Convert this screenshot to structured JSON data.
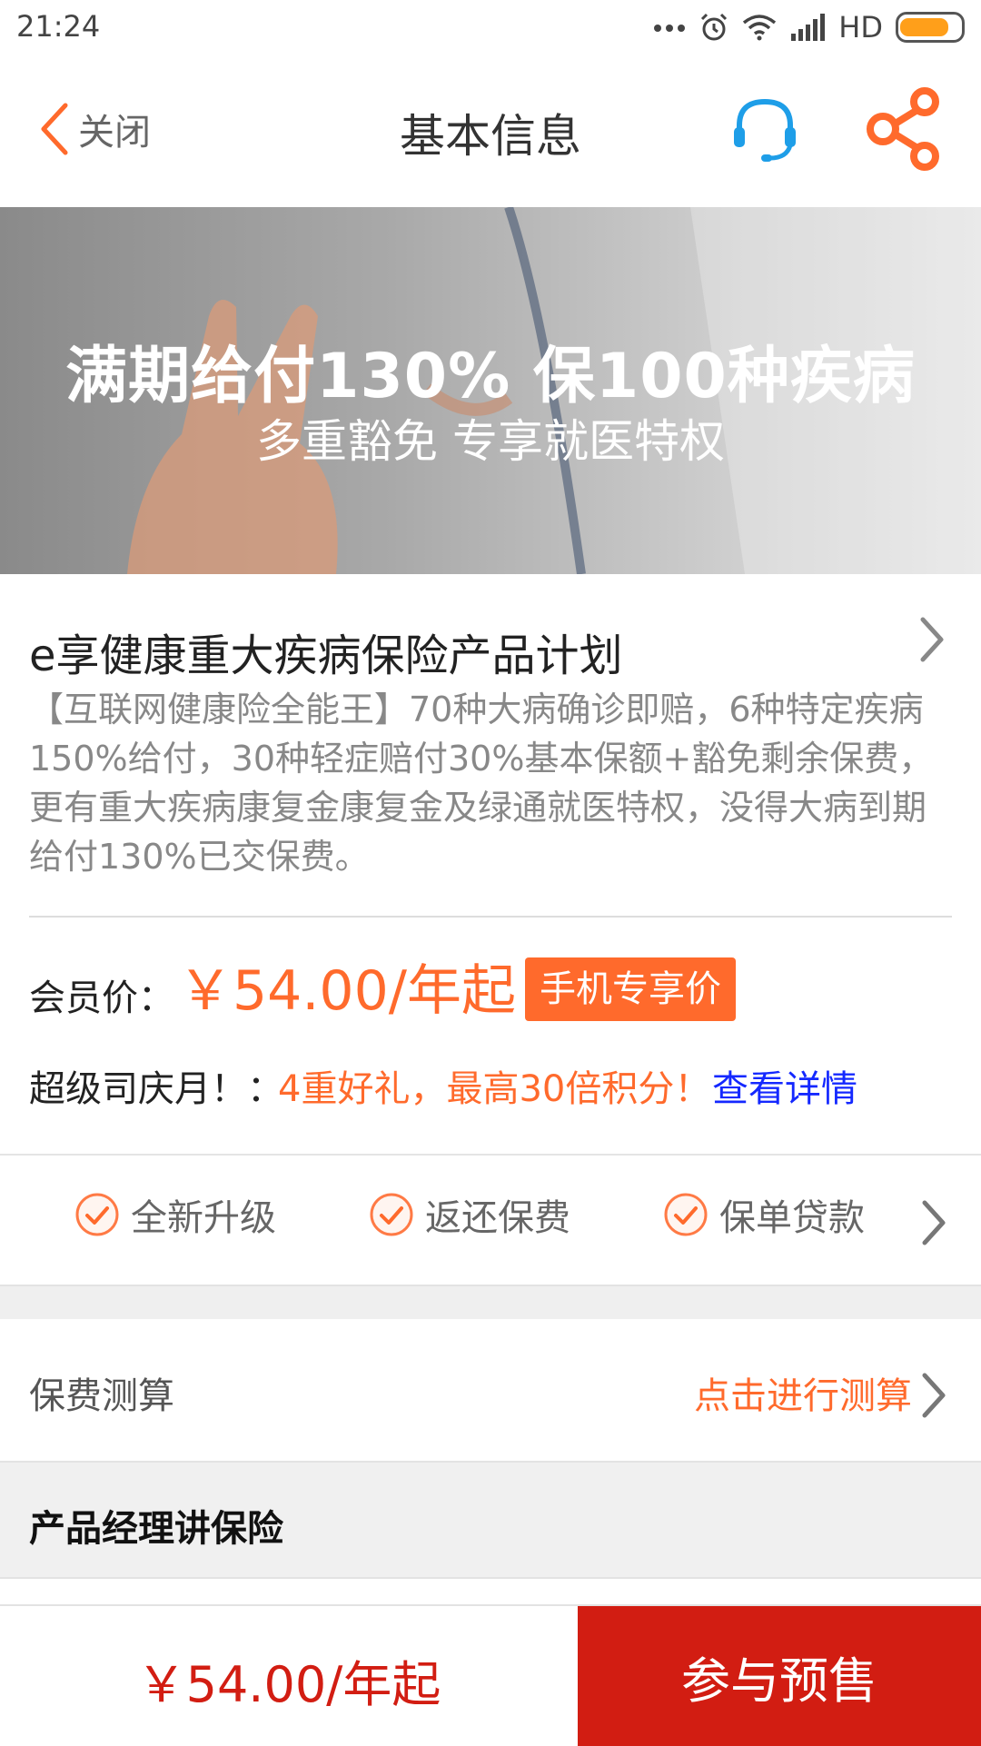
{
  "status_bar": {
    "time": "21:24",
    "network": "HD",
    "icons": [
      "more-dots-icon",
      "alarm-icon",
      "wifi-icon",
      "signal-icon",
      "battery-icon"
    ],
    "battery_level": 0.8
  },
  "header": {
    "back_label": "关闭",
    "title": "基本信息",
    "icons": [
      "chevron-left-icon",
      "headset-icon",
      "share-icon"
    ]
  },
  "banner": {
    "line1": "满期给付130%   保100种疾病",
    "line2": "多重豁免  专享就医特权"
  },
  "product": {
    "name": "e享健康重大疾病保险产品计划",
    "description": "【互联网健康险全能王】70种大病确诊即赔，6种特定疾病150%给付，30种轻症赔付30%基本保额+豁免剩余保费，更有重大疾病康复金康复金及绿通就医特权，没得大病到期给付130%已交保费。",
    "price_label": "会员价：",
    "price": "￥54.00/年起",
    "badge": "手机专享价",
    "promo_label": "超级司庆月！：",
    "promo_text": "4重好礼，最高30倍积分！",
    "promo_link": "查看详情"
  },
  "features": [
    "全新升级",
    "返还保费",
    "保单贷款"
  ],
  "calc": {
    "label": "保费测算",
    "action": "点击进行测算"
  },
  "section": {
    "title": "产品经理讲保险"
  },
  "bottom_bar": {
    "price": "￥54.00/年起",
    "cta": "参与预售"
  },
  "colors": {
    "accent_orange": "#ff6a2c",
    "cta_red": "#d21d12",
    "link_blue": "#1428ff",
    "headset_blue": "#1e9ee8"
  }
}
